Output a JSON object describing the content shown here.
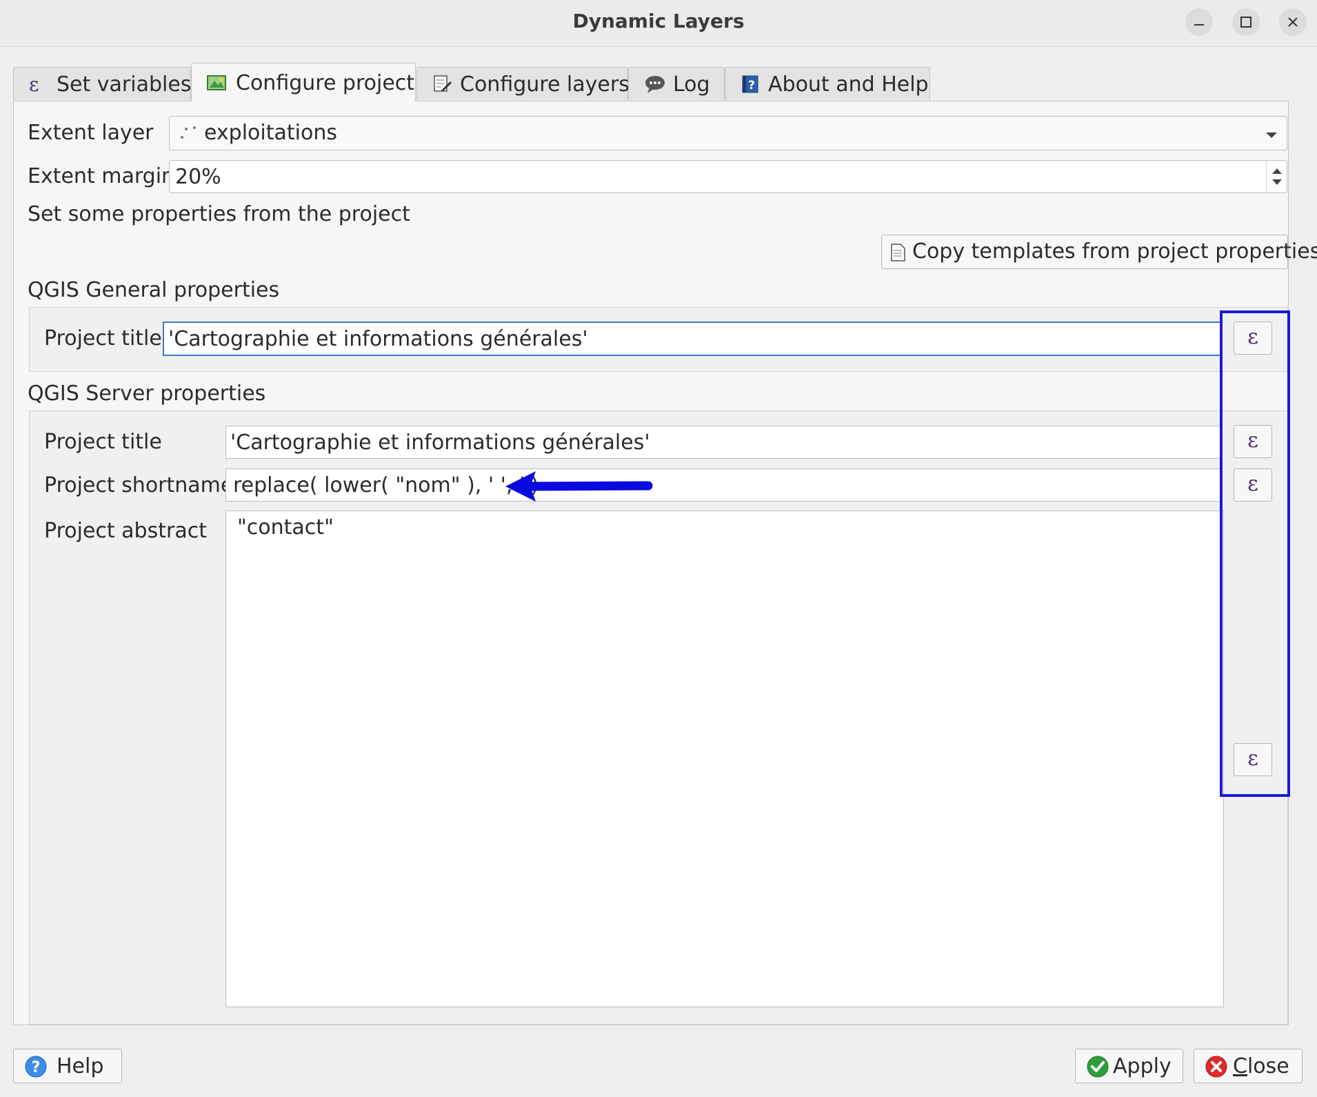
{
  "window": {
    "title": "Dynamic Layers"
  },
  "window_controls": [
    {
      "name": "minimize-icon"
    },
    {
      "name": "maximize-icon"
    },
    {
      "name": "close-icon"
    }
  ],
  "tabs": [
    {
      "label": "Set variables",
      "icon": "epsilon-icon",
      "active": false
    },
    {
      "label": "Configure project",
      "icon": "map-icon",
      "active": true
    },
    {
      "label": "Configure layers",
      "icon": "edit-layer-icon",
      "active": false
    },
    {
      "label": "Log",
      "icon": "chat-bubble-icon",
      "active": false
    },
    {
      "label": "About and Help",
      "icon": "help-book-icon",
      "active": false
    }
  ],
  "extent": {
    "layer_label": "Extent layer",
    "layer_value": "exploitations",
    "margin_label": "Extent margin",
    "margin_value": "20%"
  },
  "intro_text": "Set some properties from the project",
  "copy_button_label": "Copy templates from project properties",
  "general": {
    "heading": "QGIS General properties",
    "title_label": "Project title",
    "title_value": "'Cartographie et informations générales'"
  },
  "server": {
    "heading": "QGIS Server properties",
    "title_label": "Project title",
    "title_value": "'Cartographie et informations générales'",
    "shortname_label": "Project shortname",
    "shortname_value": "replace( lower( \"nom\" ), ' ', '')",
    "abstract_label": "Project abstract",
    "abstract_value": "\"contact\""
  },
  "expression_button_symbol": "ε",
  "annotation_colors": {
    "arrow": "#0a0ae0",
    "box": "#1a1adc"
  },
  "footer": {
    "help_label": "Help",
    "apply_label": "Apply",
    "close_label_first": "C",
    "close_label_rest": "lose"
  }
}
